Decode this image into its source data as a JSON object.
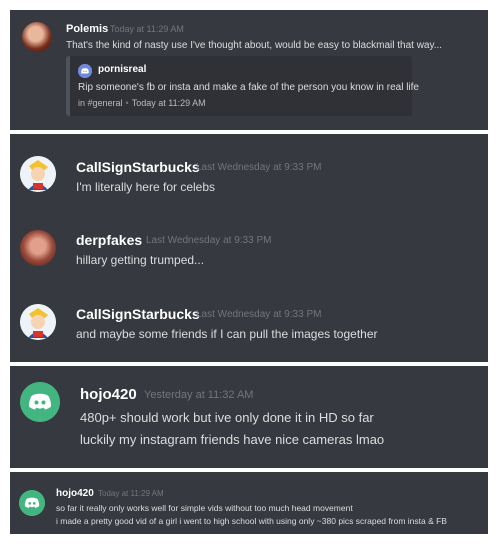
{
  "colors": {
    "background": "#36393f",
    "username": "#ffffff",
    "text": "#dcddde",
    "timestamp": "#72767d",
    "discord_blurple": "#7289da",
    "discord_green": "#43b581"
  },
  "panel1": {
    "author": "Polemis",
    "time": "Today at 11:29 AM",
    "text": "That's the kind of nasty use I've thought about, would be easy to blackmail that way...",
    "embed": {
      "author": "pornisreal",
      "text": "Rip someone's fb or insta and make a fake of the person you know in real life",
      "channel": "in #general",
      "separator": "•",
      "time": "Today at 11:29 AM",
      "icon": "discord-logo-icon"
    }
  },
  "panel2": {
    "messages": [
      {
        "author": "CallSignStarbucks",
        "time": "Last Wednesday at 9:33 PM",
        "text": "I'm literally here for celebs",
        "avatar": "cartoon-avatar"
      },
      {
        "author": "derpfakes",
        "time": "Last Wednesday at 9:33 PM",
        "text": "hillary getting trumped...",
        "avatar": "photo-avatar"
      },
      {
        "author": "CallSignStarbucks",
        "time": "Last Wednesday at 9:33 PM",
        "text": "and maybe some friends if I can pull the images together",
        "avatar": "cartoon-avatar"
      }
    ]
  },
  "panel3": {
    "author": "hojo420",
    "time": "Yesterday at 11:32 AM",
    "lines": [
      "480p+ should work but ive only done it in HD so far",
      "luckily my instagram friends have nice cameras lmao"
    ],
    "avatar": "discord-logo-icon"
  },
  "panel4": {
    "author": "hojo420",
    "time": "Today at 11:29 AM",
    "lines": [
      "so far it really only works well for simple vids without too much head movement",
      "i made a pretty good vid of a girl i went to high school with using only ~380 pics scraped from insta & FB"
    ],
    "avatar": "discord-logo-icon"
  }
}
